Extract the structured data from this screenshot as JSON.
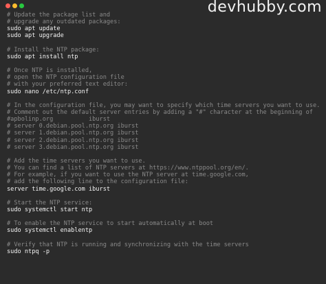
{
  "window": {
    "brand": "devhubby.com",
    "traffic_lights": [
      {
        "name": "close",
        "color": "#ff5f57"
      },
      {
        "name": "minimize",
        "color": "#febc2e"
      },
      {
        "name": "maximize",
        "color": "#28c840"
      }
    ]
  },
  "colors": {
    "background": "#2b2b2b",
    "comment": "#8a8a8a",
    "command": "#f4f4f4"
  },
  "lines": [
    {
      "type": "comment",
      "text": "# Update the package list and"
    },
    {
      "type": "comment",
      "text": "# upgrade any outdated packages:"
    },
    {
      "type": "cmd",
      "text": "sudo apt update"
    },
    {
      "type": "cmd",
      "text": "sudo apt upgrade"
    },
    {
      "type": "blank",
      "text": " "
    },
    {
      "type": "comment",
      "text": "# Install the NTP package:"
    },
    {
      "type": "cmd",
      "text": "sudo apt install ntp"
    },
    {
      "type": "blank",
      "text": " "
    },
    {
      "type": "comment",
      "text": "# Once NTP is installed,"
    },
    {
      "type": "comment",
      "text": "# open the NTP configuration file"
    },
    {
      "type": "comment",
      "text": "# with your preferred text editor:"
    },
    {
      "type": "cmd",
      "text": "sudo nano /etc/ntp.conf"
    },
    {
      "type": "blank",
      "text": " "
    },
    {
      "type": "comment",
      "text": "# In the configuration file, you may want to specify which time servers you want to use."
    },
    {
      "type": "comment",
      "text": "# Comment out the default server entries by adding a \"#\" character at the beginning of"
    },
    {
      "type": "comment",
      "text": "#apbolinp.org          iburst"
    },
    {
      "type": "comment",
      "text": "# server 0.debian.pool.ntp.org iburst"
    },
    {
      "type": "comment",
      "text": "# server 1.debian.pool.ntp.org iburst"
    },
    {
      "type": "comment",
      "text": "# server 2.debian.pool.ntp.org iburst"
    },
    {
      "type": "comment",
      "text": "# server 3.debian.pool.ntp.org iburst"
    },
    {
      "type": "blank",
      "text": " "
    },
    {
      "type": "comment",
      "text": "# Add the time servers you want to use."
    },
    {
      "type": "comment",
      "text": "# You can find a list of NTP servers at https://www.ntppool.org/en/."
    },
    {
      "type": "comment",
      "text": "# For example, if you want to use the NTP server at time.google.com,"
    },
    {
      "type": "comment",
      "text": "# add the following line to the configuration file:"
    },
    {
      "type": "cmd",
      "text": "server time.google.com iburst"
    },
    {
      "type": "blank",
      "text": " "
    },
    {
      "type": "comment",
      "text": "# Start the NTP service:"
    },
    {
      "type": "cmd",
      "text": "sudo systemctl start ntp"
    },
    {
      "type": "blank",
      "text": " "
    },
    {
      "type": "comment",
      "text": "# To enable the NTP service to start automatically at boot"
    },
    {
      "type": "cmd",
      "text": "sudo systemctl enablentp"
    },
    {
      "type": "blank",
      "text": " "
    },
    {
      "type": "comment",
      "text": "# Verify that NTP is running and synchronizing with the time servers"
    },
    {
      "type": "cmd",
      "text": "sudo ntpq -p"
    }
  ]
}
